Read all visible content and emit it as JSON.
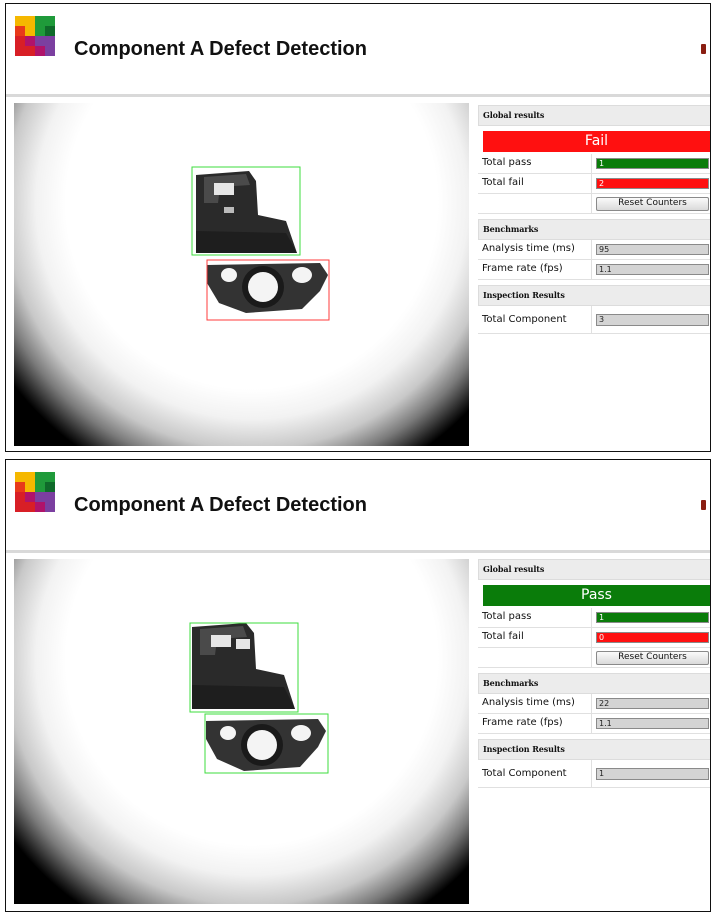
{
  "logo_colors": [
    "#f5b800",
    "#f5b800",
    "#1f9a3a",
    "#1f9a3a",
    "#e83a1a",
    "#f5b800",
    "#1f9a3a",
    "#0f6a2a",
    "#d81f26",
    "#b0136a",
    "#7b3fa0",
    "#7b3fa0",
    "#d81f26",
    "#d81f26",
    "#b0136a",
    "#7b3fa0"
  ],
  "colors": {
    "pass": "#0a7c0a",
    "fail": "#ff1010"
  },
  "screens": [
    {
      "title": "Component A Defect Detection",
      "global": {
        "header": "Global results",
        "status": "Fail",
        "status_state": "fail",
        "total_pass_label": "Total pass",
        "total_pass": "1",
        "total_fail_label": "Total fail",
        "total_fail": "2",
        "reset_label": "Reset Counters"
      },
      "benchmarks": {
        "header": "Benchmarks",
        "analysis_label": "Analysis time (ms)",
        "analysis_value": "95",
        "frame_label": "Frame rate (fps)",
        "frame_value": "1.1"
      },
      "inspection": {
        "header": "Inspection Results",
        "component_label": "Total Component",
        "component_value": "3"
      },
      "detections": [
        {
          "part": "upper-part",
          "state": "pass"
        },
        {
          "part": "lower-part",
          "state": "fail"
        }
      ]
    },
    {
      "title": "Component A Defect Detection",
      "global": {
        "header": "Global results",
        "status": "Pass",
        "status_state": "pass",
        "total_pass_label": "Total pass",
        "total_pass": "1",
        "total_fail_label": "Total fail",
        "total_fail": "0",
        "reset_label": "Reset Counters"
      },
      "benchmarks": {
        "header": "Benchmarks",
        "analysis_label": "Analysis time (ms)",
        "analysis_value": "22",
        "frame_label": "Frame rate (fps)",
        "frame_value": "1.1"
      },
      "inspection": {
        "header": "Inspection Results",
        "component_label": "Total Component",
        "component_value": "1"
      },
      "detections": [
        {
          "part": "upper-part",
          "state": "pass"
        },
        {
          "part": "lower-part",
          "state": "pass"
        }
      ]
    }
  ]
}
